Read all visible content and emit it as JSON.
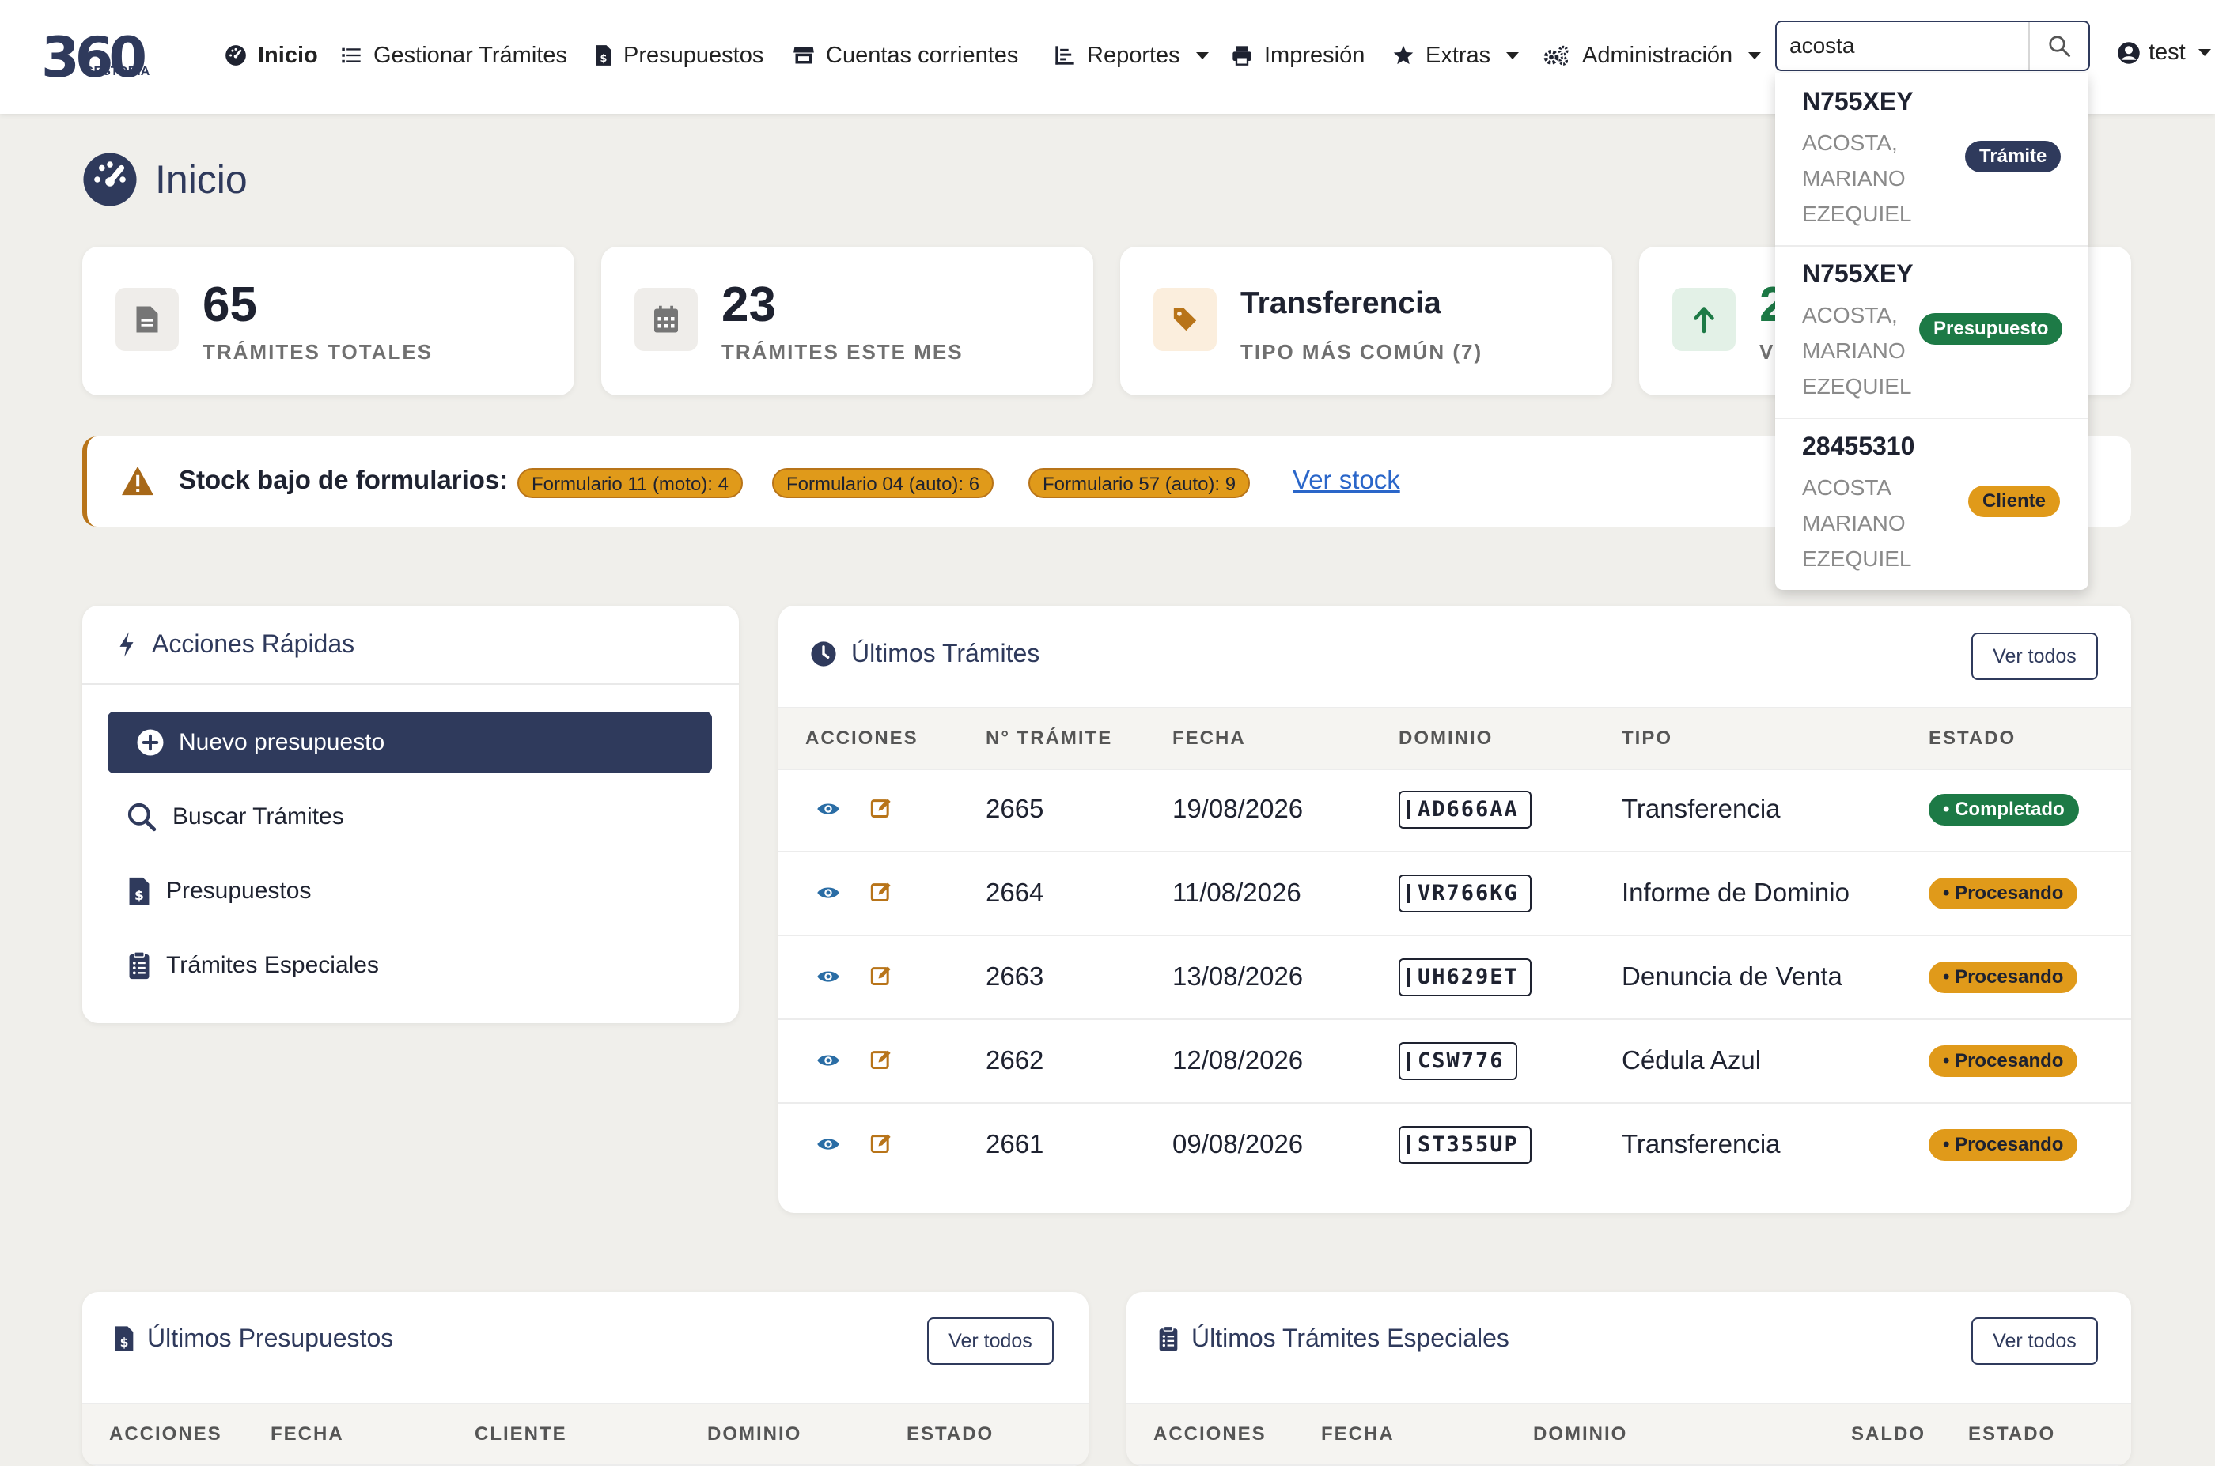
{
  "logo": {
    "big": "360",
    "small": "GESTORIA"
  },
  "nav": {
    "inicio": "Inicio",
    "gestionar": "Gestionar Trámites",
    "presupuestos": "Presupuestos",
    "cuentas": "Cuentas corrientes",
    "reportes": "Reportes",
    "impresion": "Impresión",
    "extras": "Extras",
    "administracion": "Administración",
    "user": "test"
  },
  "search": {
    "value": "acosta"
  },
  "search_results": [
    {
      "code": "N755XEY",
      "name": "ACOSTA, MARIANO EZEQUIEL",
      "badge": "Trámite",
      "badge_color": "#2f3a5c"
    },
    {
      "code": "N755XEY",
      "name": "ACOSTA, MARIANO EZEQUIEL",
      "badge": "Presupuesto",
      "badge_color": "#1d7a46"
    },
    {
      "code": "28455310",
      "name": "ACOSTA MARIANO EZEQUIEL",
      "badge": "Cliente",
      "badge_color": "#e09a1a"
    }
  ],
  "page": {
    "title": "Inicio"
  },
  "stats": [
    {
      "value": "65",
      "label": "TRÁMITES TOTALES"
    },
    {
      "value": "23",
      "label": "TRÁMITES ESTE MES"
    },
    {
      "value": "Transferencia",
      "label": "TIPO MÁS COMÚN (7)"
    },
    {
      "value": "2",
      "label": "V"
    }
  ],
  "alert": {
    "title": "Stock bajo de formularios:",
    "pills": [
      "Formulario 11 (moto): 4",
      "Formulario 04 (auto): 6",
      "Formulario 57 (auto): 9"
    ],
    "link": "Ver stock"
  },
  "quick_actions": {
    "title": "Acciones Rápidas",
    "primary": "Nuevo presupuesto",
    "items": [
      "Buscar Trámites",
      "Presupuestos",
      "Trámites Especiales"
    ]
  },
  "ultimos_tramites": {
    "title": "Últimos Trámites",
    "view_all": "Ver todos",
    "columns": [
      "ACCIONES",
      "N° TRÁMITE",
      "FECHA",
      "DOMINIO",
      "TIPO",
      "ESTADO"
    ],
    "rows": [
      {
        "num": "2665",
        "fecha": "19/08/2026",
        "dominio": "AD666AA",
        "tipo": "Transferencia",
        "estado": "• Completado"
      },
      {
        "num": "2664",
        "fecha": "11/08/2026",
        "dominio": "VR766KG",
        "tipo": "Informe de Dominio",
        "estado": "• Procesando"
      },
      {
        "num": "2663",
        "fecha": "13/08/2026",
        "dominio": "UH629ET",
        "tipo": "Denuncia de Venta",
        "estado": "• Procesando"
      },
      {
        "num": "2662",
        "fecha": "12/08/2026",
        "dominio": "CSW776",
        "tipo": "Cédula Azul",
        "estado": "• Procesando"
      },
      {
        "num": "2661",
        "fecha": "09/08/2026",
        "dominio": "ST355UP",
        "tipo": "Transferencia",
        "estado": "• Procesando"
      }
    ]
  },
  "ultimos_presupuestos": {
    "title": "Últimos Presupuestos",
    "view_all": "Ver todos",
    "columns": [
      "ACCIONES",
      "FECHA",
      "CLIENTE",
      "DOMINIO",
      "ESTADO"
    ]
  },
  "ultimos_especiales": {
    "title": "Últimos Trámites Especiales",
    "view_all": "Ver todos",
    "columns": [
      "ACCIONES",
      "FECHA",
      "DOMINIO",
      "SALDO",
      "ESTADO"
    ]
  },
  "colors": {
    "primary": "#2f3a5c",
    "success": "#1d7a46",
    "warning": "#e09a1a",
    "link": "#2a66c9",
    "background": "#f0efeb"
  }
}
